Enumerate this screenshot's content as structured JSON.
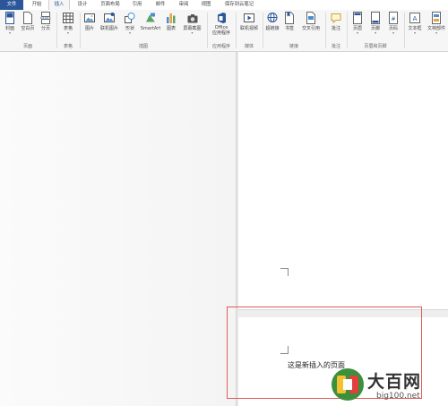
{
  "tabs": [
    {
      "label": "文件"
    },
    {
      "label": "开始"
    },
    {
      "label": "插入"
    },
    {
      "label": "设计"
    },
    {
      "label": "页面布局"
    },
    {
      "label": "引用"
    },
    {
      "label": "邮件"
    },
    {
      "label": "审阅"
    },
    {
      "label": "视图"
    },
    {
      "label": "保存到云笔记"
    }
  ],
  "ribbon": {
    "groups": {
      "pages": "页面",
      "tables": "表格",
      "illustrations": "插图",
      "apps": "应用程序",
      "media": "媒体",
      "links": "链接",
      "comments": "批注",
      "header_footer": "页眉和页脚"
    },
    "buttons": {
      "cover": "封面",
      "blank_page": "空白页",
      "page_break": "分页",
      "table": "表格",
      "picture": "图片",
      "online_picture": "联机图片",
      "shapes": "形状",
      "smartart": "SmartArt",
      "chart": "图表",
      "screenshot": "屏幕截图",
      "office_line1": "Office",
      "office_line2": "应用程序",
      "online_video": "联机视频",
      "hyperlink": "超链接",
      "bookmark": "书签",
      "cross_reference": "交叉引用",
      "comment": "批注",
      "header": "页眉",
      "footer": "页脚",
      "page_number": "页码",
      "text_box": "文本框",
      "document_parts": "文档部件"
    }
  },
  "document": {
    "inserted_text": "这是新插入的页面"
  },
  "watermark": {
    "title": "大百网",
    "url": "big100.net"
  },
  "colors": {
    "file_tab": "#2b579a",
    "highlight_frame": "#e05a5a"
  }
}
